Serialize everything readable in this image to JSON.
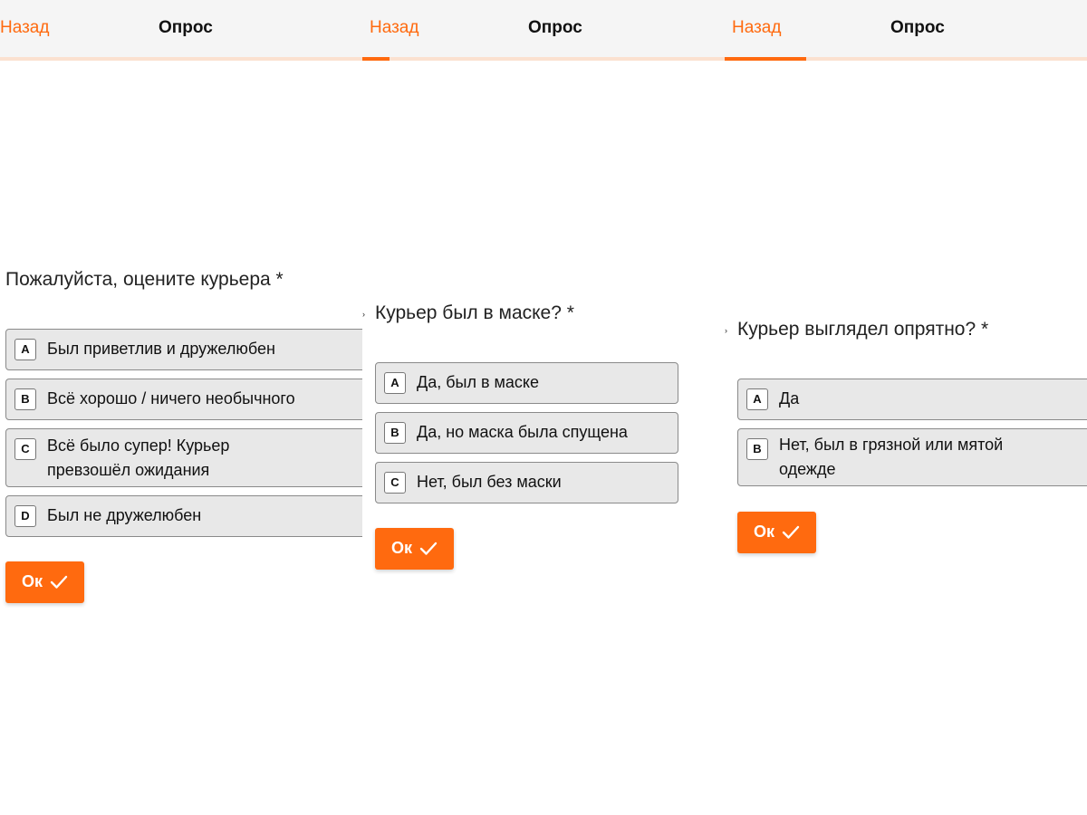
{
  "colors": {
    "accent": "#ff6a0f",
    "progress_track": "#fbe1d0",
    "option_bg": "#e8e8e8",
    "header_bg": "#f5f5f5"
  },
  "screens": [
    {
      "header": {
        "back": "Назад",
        "title": "Опрос",
        "progress": 0.0
      },
      "question": "Пожалуйста, оцените курьера *",
      "options": [
        {
          "key": "A",
          "label": "Был приветлив и дружелюбен"
        },
        {
          "key": "B",
          "label": "Всё хорошо / ничего необычного"
        },
        {
          "key": "C",
          "label": "Всё было супер! Курьер\nпревзошёл ожидания"
        },
        {
          "key": "D",
          "label": "Был не дружелюбен"
        }
      ],
      "ok_label": "Ок",
      "ok_icon": "checkmark-icon"
    },
    {
      "header": {
        "back": "Назад",
        "title": "Опрос",
        "progress": 0.075
      },
      "question": "Курьер был в маске? *",
      "question_marker": "›",
      "options": [
        {
          "key": "A",
          "label": "Да, был в маске"
        },
        {
          "key": "B",
          "label": "Да, но маска была спущена"
        },
        {
          "key": "C",
          "label": "Нет, был без маски"
        }
      ],
      "ok_label": "Ок",
      "ok_icon": "checkmark-icon"
    },
    {
      "header": {
        "back": "Назад",
        "title": "Опрос",
        "progress": 0.225
      },
      "question": "Курьер выглядел опрятно? *",
      "question_marker": "›",
      "options": [
        {
          "key": "A",
          "label": "Да"
        },
        {
          "key": "B",
          "label": "Нет, был в грязной или мятой\nодежде"
        }
      ],
      "ok_label": "Ок",
      "ok_icon": "checkmark-icon"
    }
  ]
}
